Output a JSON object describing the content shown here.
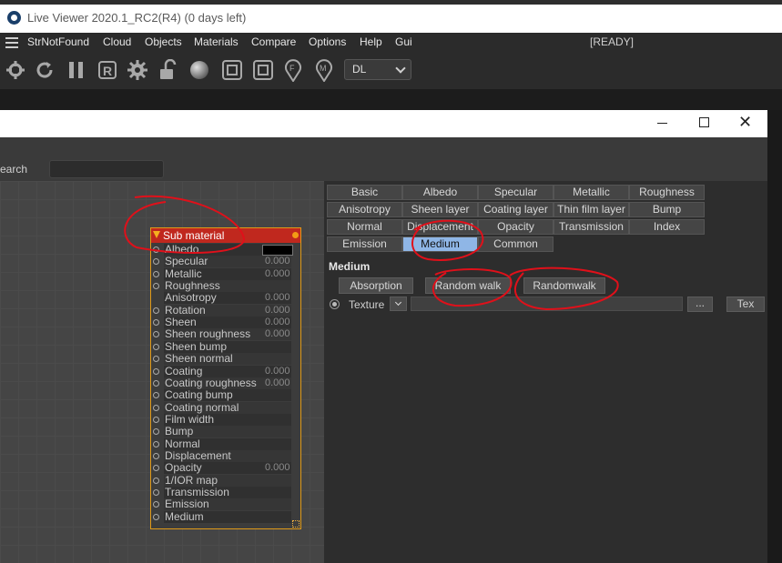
{
  "window": {
    "title": "Live Viewer 2020.1_RC2(R4) (0 days left)"
  },
  "menubar": {
    "items": [
      "StrNotFound",
      "Cloud",
      "Objects",
      "Materials",
      "Compare",
      "Options",
      "Help",
      "Gui"
    ],
    "status": "[READY]"
  },
  "toolbar": {
    "icons": [
      "gear-scissors-icon",
      "refresh-icon",
      "pause-icon",
      "r-icon",
      "settings-gear-icon",
      "lock-icon",
      "material-sphere-icon",
      "region-icon",
      "region-alt-icon",
      "focus-pin-icon",
      "material-pin-icon"
    ],
    "render_mode": "DL"
  },
  "dialog": {
    "close_glyph": "✕",
    "search_label": "earch",
    "search_value": ""
  },
  "node": {
    "title": "Sub material",
    "ports": [
      {
        "label": "Albedo",
        "value": "",
        "swatch": "#000000"
      },
      {
        "label": "Specular",
        "value": "0.000"
      },
      {
        "label": "Metallic",
        "value": "0.000"
      },
      {
        "label": "Roughness",
        "value": ""
      },
      {
        "label": "Anisotropy",
        "value": "0.000",
        "noport": true
      },
      {
        "label": "Rotation",
        "value": "0.000"
      },
      {
        "label": "Sheen",
        "value": "0.000"
      },
      {
        "label": "Sheen roughness",
        "value": "0.000"
      },
      {
        "label": "Sheen bump",
        "value": ""
      },
      {
        "label": "Sheen normal",
        "value": ""
      },
      {
        "label": "Coating",
        "value": "0.000"
      },
      {
        "label": "Coating roughness",
        "value": "0.000"
      },
      {
        "label": "Coating bump",
        "value": ""
      },
      {
        "label": "Coating normal",
        "value": ""
      },
      {
        "label": "Film width",
        "value": ""
      },
      {
        "label": "Bump",
        "value": ""
      },
      {
        "label": "Normal",
        "value": ""
      },
      {
        "label": "Displacement",
        "value": ""
      },
      {
        "label": "Opacity",
        "value": "0.000"
      },
      {
        "label": "1/IOR map",
        "value": ""
      },
      {
        "label": "Transmission",
        "value": ""
      },
      {
        "label": "Emission",
        "value": ""
      },
      {
        "label": "Medium",
        "value": ""
      }
    ]
  },
  "tabs": [
    [
      "Basic",
      "Albedo",
      "Specular",
      "Metallic",
      "Roughness"
    ],
    [
      "Anisotropy",
      "Sheen layer",
      "Coating layer",
      "Thin film layer",
      "Bump"
    ],
    [
      "Normal",
      "Displacement",
      "Opacity",
      "Transmission",
      "Index"
    ],
    [
      "Emission",
      "Medium",
      "Common"
    ]
  ],
  "active_tab": "Medium",
  "medium": {
    "heading": "Medium",
    "buttons": [
      "Absorption",
      "Random walk",
      "Randomwalk"
    ],
    "texture_label": "Texture",
    "texture_path": "",
    "browse_label": "...",
    "tex_button": "Tex"
  },
  "colors": {
    "node_header": "#c0281e",
    "node_border": "#e09a18",
    "active_tab": "#8fb6e6",
    "annotation": "#e0101a"
  }
}
